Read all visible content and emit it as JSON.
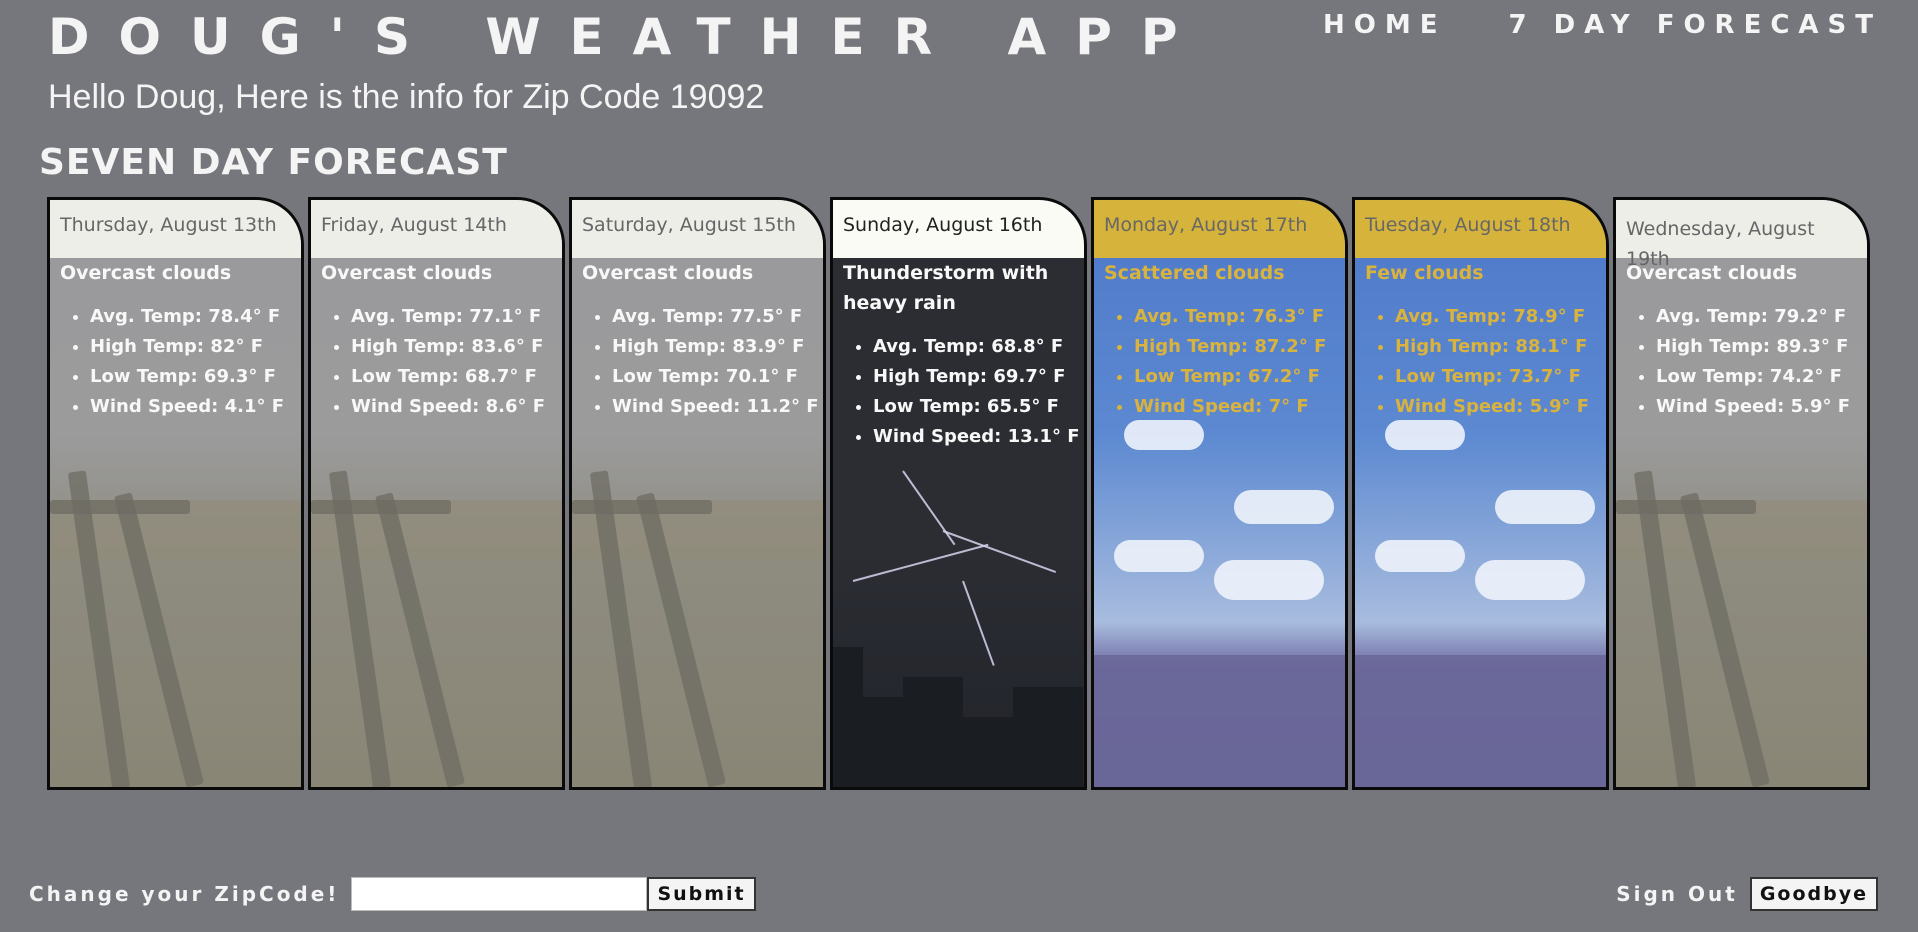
{
  "header": {
    "app_title": "DOUG'S WEATHER APP",
    "nav": [
      {
        "label": "HOME"
      },
      {
        "label": "7 DAY FORECAST"
      }
    ]
  },
  "greeting": "Hello Doug, Here is the info for Zip Code 19092",
  "section_title": "SEVEN DAY FORECAST",
  "forecast": [
    {
      "date": "Thursday, August 13th",
      "condition": "Overcast clouds",
      "avg": "Avg. Temp: 78.4° F",
      "high": "High Temp: 82° F",
      "low": "Low Temp: 69.3° F",
      "wind": "Wind Speed: 4.1° F"
    },
    {
      "date": "Friday, August 14th",
      "condition": "Overcast clouds",
      "avg": "Avg. Temp: 77.1° F",
      "high": "High Temp: 83.6° F",
      "low": "Low Temp: 68.7° F",
      "wind": "Wind Speed: 8.6° F"
    },
    {
      "date": "Saturday, August 15th",
      "condition": "Overcast clouds",
      "avg": "Avg. Temp: 77.5° F",
      "high": "High Temp: 83.9° F",
      "low": "Low Temp: 70.1° F",
      "wind": "Wind Speed: 11.2° F"
    },
    {
      "date": "Sunday, August 16th",
      "condition": "Thunderstorm with heavy rain",
      "avg": "Avg. Temp: 68.8° F",
      "high": "High Temp: 69.7° F",
      "low": "Low Temp: 65.5° F",
      "wind": "Wind Speed: 13.1° F"
    },
    {
      "date": "Monday, August 17th",
      "condition": "Scattered clouds",
      "avg": "Avg. Temp: 76.3° F",
      "high": "High Temp: 87.2° F",
      "low": "Low Temp: 67.2° F",
      "wind": "Wind Speed: 7° F"
    },
    {
      "date": "Tuesday, August 18th",
      "condition": "Few clouds",
      "avg": "Avg. Temp: 78.9° F",
      "high": "High Temp: 88.1° F",
      "low": "Low Temp: 73.7° F",
      "wind": "Wind Speed: 5.9° F"
    },
    {
      "date": "Wednesday, August 19th",
      "condition": "Overcast clouds",
      "avg": "Avg. Temp: 79.2° F",
      "high": "High Temp: 89.3° F",
      "low": "Low Temp: 74.2° F",
      "wind": "Wind Speed: 5.9° F"
    }
  ],
  "footer": {
    "zip_label": "Change your ZipCode!",
    "zip_value": "",
    "submit_label": "Submit",
    "signout_label": "Sign Out",
    "goodbye_label": "Goodbye"
  },
  "colors": {
    "background": "#76777c",
    "header_yellow": "#d6b33b",
    "text_yellow": "#dab33c"
  }
}
